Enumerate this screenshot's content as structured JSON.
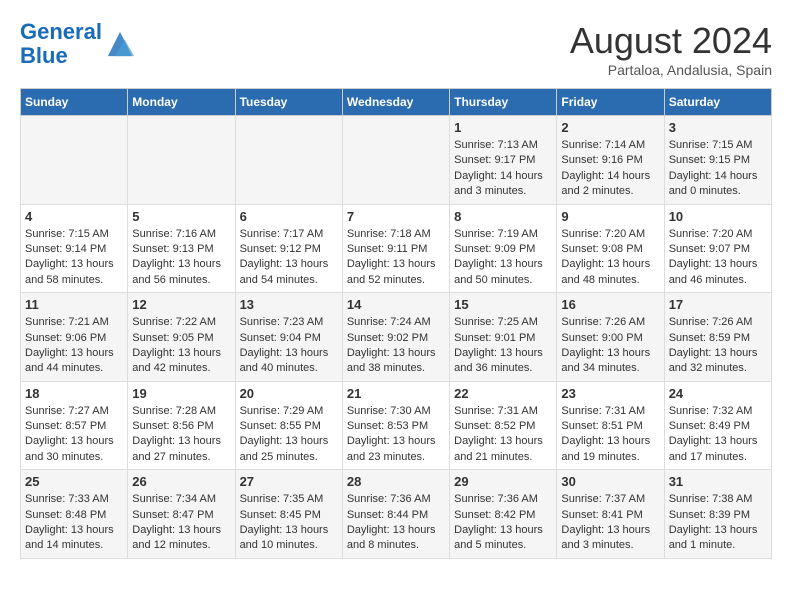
{
  "logo": {
    "line1": "General",
    "line2": "Blue"
  },
  "title": "August 2024",
  "subtitle": "Partaloa, Andalusia, Spain",
  "days_of_week": [
    "Sunday",
    "Monday",
    "Tuesday",
    "Wednesday",
    "Thursday",
    "Friday",
    "Saturday"
  ],
  "weeks": [
    [
      {
        "day": "",
        "info": ""
      },
      {
        "day": "",
        "info": ""
      },
      {
        "day": "",
        "info": ""
      },
      {
        "day": "",
        "info": ""
      },
      {
        "day": "1",
        "info": "Sunrise: 7:13 AM\nSunset: 9:17 PM\nDaylight: 14 hours\nand 3 minutes."
      },
      {
        "day": "2",
        "info": "Sunrise: 7:14 AM\nSunset: 9:16 PM\nDaylight: 14 hours\nand 2 minutes."
      },
      {
        "day": "3",
        "info": "Sunrise: 7:15 AM\nSunset: 9:15 PM\nDaylight: 14 hours\nand 0 minutes."
      }
    ],
    [
      {
        "day": "4",
        "info": "Sunrise: 7:15 AM\nSunset: 9:14 PM\nDaylight: 13 hours\nand 58 minutes."
      },
      {
        "day": "5",
        "info": "Sunrise: 7:16 AM\nSunset: 9:13 PM\nDaylight: 13 hours\nand 56 minutes."
      },
      {
        "day": "6",
        "info": "Sunrise: 7:17 AM\nSunset: 9:12 PM\nDaylight: 13 hours\nand 54 minutes."
      },
      {
        "day": "7",
        "info": "Sunrise: 7:18 AM\nSunset: 9:11 PM\nDaylight: 13 hours\nand 52 minutes."
      },
      {
        "day": "8",
        "info": "Sunrise: 7:19 AM\nSunset: 9:09 PM\nDaylight: 13 hours\nand 50 minutes."
      },
      {
        "day": "9",
        "info": "Sunrise: 7:20 AM\nSunset: 9:08 PM\nDaylight: 13 hours\nand 48 minutes."
      },
      {
        "day": "10",
        "info": "Sunrise: 7:20 AM\nSunset: 9:07 PM\nDaylight: 13 hours\nand 46 minutes."
      }
    ],
    [
      {
        "day": "11",
        "info": "Sunrise: 7:21 AM\nSunset: 9:06 PM\nDaylight: 13 hours\nand 44 minutes."
      },
      {
        "day": "12",
        "info": "Sunrise: 7:22 AM\nSunset: 9:05 PM\nDaylight: 13 hours\nand 42 minutes."
      },
      {
        "day": "13",
        "info": "Sunrise: 7:23 AM\nSunset: 9:04 PM\nDaylight: 13 hours\nand 40 minutes."
      },
      {
        "day": "14",
        "info": "Sunrise: 7:24 AM\nSunset: 9:02 PM\nDaylight: 13 hours\nand 38 minutes."
      },
      {
        "day": "15",
        "info": "Sunrise: 7:25 AM\nSunset: 9:01 PM\nDaylight: 13 hours\nand 36 minutes."
      },
      {
        "day": "16",
        "info": "Sunrise: 7:26 AM\nSunset: 9:00 PM\nDaylight: 13 hours\nand 34 minutes."
      },
      {
        "day": "17",
        "info": "Sunrise: 7:26 AM\nSunset: 8:59 PM\nDaylight: 13 hours\nand 32 minutes."
      }
    ],
    [
      {
        "day": "18",
        "info": "Sunrise: 7:27 AM\nSunset: 8:57 PM\nDaylight: 13 hours\nand 30 minutes."
      },
      {
        "day": "19",
        "info": "Sunrise: 7:28 AM\nSunset: 8:56 PM\nDaylight: 13 hours\nand 27 minutes."
      },
      {
        "day": "20",
        "info": "Sunrise: 7:29 AM\nSunset: 8:55 PM\nDaylight: 13 hours\nand 25 minutes."
      },
      {
        "day": "21",
        "info": "Sunrise: 7:30 AM\nSunset: 8:53 PM\nDaylight: 13 hours\nand 23 minutes."
      },
      {
        "day": "22",
        "info": "Sunrise: 7:31 AM\nSunset: 8:52 PM\nDaylight: 13 hours\nand 21 minutes."
      },
      {
        "day": "23",
        "info": "Sunrise: 7:31 AM\nSunset: 8:51 PM\nDaylight: 13 hours\nand 19 minutes."
      },
      {
        "day": "24",
        "info": "Sunrise: 7:32 AM\nSunset: 8:49 PM\nDaylight: 13 hours\nand 17 minutes."
      }
    ],
    [
      {
        "day": "25",
        "info": "Sunrise: 7:33 AM\nSunset: 8:48 PM\nDaylight: 13 hours\nand 14 minutes."
      },
      {
        "day": "26",
        "info": "Sunrise: 7:34 AM\nSunset: 8:47 PM\nDaylight: 13 hours\nand 12 minutes."
      },
      {
        "day": "27",
        "info": "Sunrise: 7:35 AM\nSunset: 8:45 PM\nDaylight: 13 hours\nand 10 minutes."
      },
      {
        "day": "28",
        "info": "Sunrise: 7:36 AM\nSunset: 8:44 PM\nDaylight: 13 hours\nand 8 minutes."
      },
      {
        "day": "29",
        "info": "Sunrise: 7:36 AM\nSunset: 8:42 PM\nDaylight: 13 hours\nand 5 minutes."
      },
      {
        "day": "30",
        "info": "Sunrise: 7:37 AM\nSunset: 8:41 PM\nDaylight: 13 hours\nand 3 minutes."
      },
      {
        "day": "31",
        "info": "Sunrise: 7:38 AM\nSunset: 8:39 PM\nDaylight: 13 hours\nand 1 minute."
      }
    ]
  ]
}
